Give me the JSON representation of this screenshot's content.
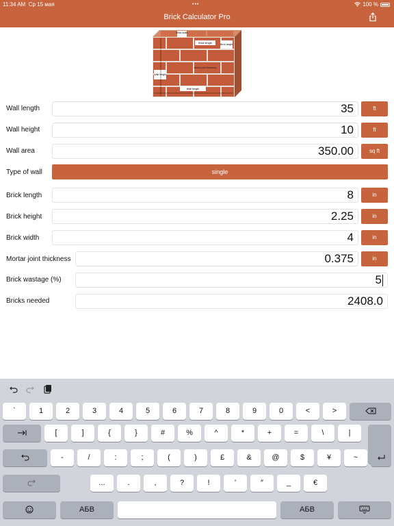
{
  "status_bar": {
    "time": "11:34 AM",
    "date": "Ср 15 мая",
    "battery": "100 %"
  },
  "app": {
    "title": "Brick Calculator Pro"
  },
  "diagram_labels": {
    "brick_width": "Brick width",
    "brick_length": "Brick length",
    "brick_height": "Brick height",
    "mortar": "Mortar joint thickness",
    "wall_height": "Wall height",
    "wall_length": "Wall length"
  },
  "form": {
    "wall_length": {
      "label": "Wall length",
      "value": "35",
      "unit": "ft"
    },
    "wall_height": {
      "label": "Wall height",
      "value": "10",
      "unit": "ft"
    },
    "wall_area": {
      "label": "Wall area",
      "value": "350.00",
      "unit": "sq ft"
    },
    "type_of_wall": {
      "label": "Type of wall",
      "value": "single"
    },
    "brick_length": {
      "label": "Brick length",
      "value": "8",
      "unit": "in"
    },
    "brick_height": {
      "label": "Brick height",
      "value": "2.25",
      "unit": "in"
    },
    "brick_width": {
      "label": "Brick width",
      "value": "4",
      "unit": "in"
    },
    "mortar": {
      "label": "Mortar joint thickness",
      "value": "0.375",
      "unit": "in"
    },
    "wastage": {
      "label": "Brick wastage (%)",
      "value": "5"
    },
    "bricks_needed": {
      "label": "Bricks needed",
      "value": "2408.0"
    }
  },
  "keyboard": {
    "row1": [
      "`",
      "1",
      "2",
      "3",
      "4",
      "5",
      "6",
      "7",
      "8",
      "9",
      "0",
      "<",
      ">"
    ],
    "row2": [
      "[",
      "]",
      "{",
      "}",
      "#",
      "%",
      "^",
      "*",
      "+",
      "=",
      "\\",
      "|"
    ],
    "row3": [
      "-",
      "/",
      ":",
      ";",
      "(",
      ")",
      "£",
      "&",
      "@",
      "$",
      "¥",
      "~"
    ],
    "row4": [
      "...",
      ".",
      ",",
      "?",
      "!",
      "’",
      "″",
      "_",
      "€"
    ],
    "lang_left": "АБВ",
    "lang_right": "АБВ"
  }
}
